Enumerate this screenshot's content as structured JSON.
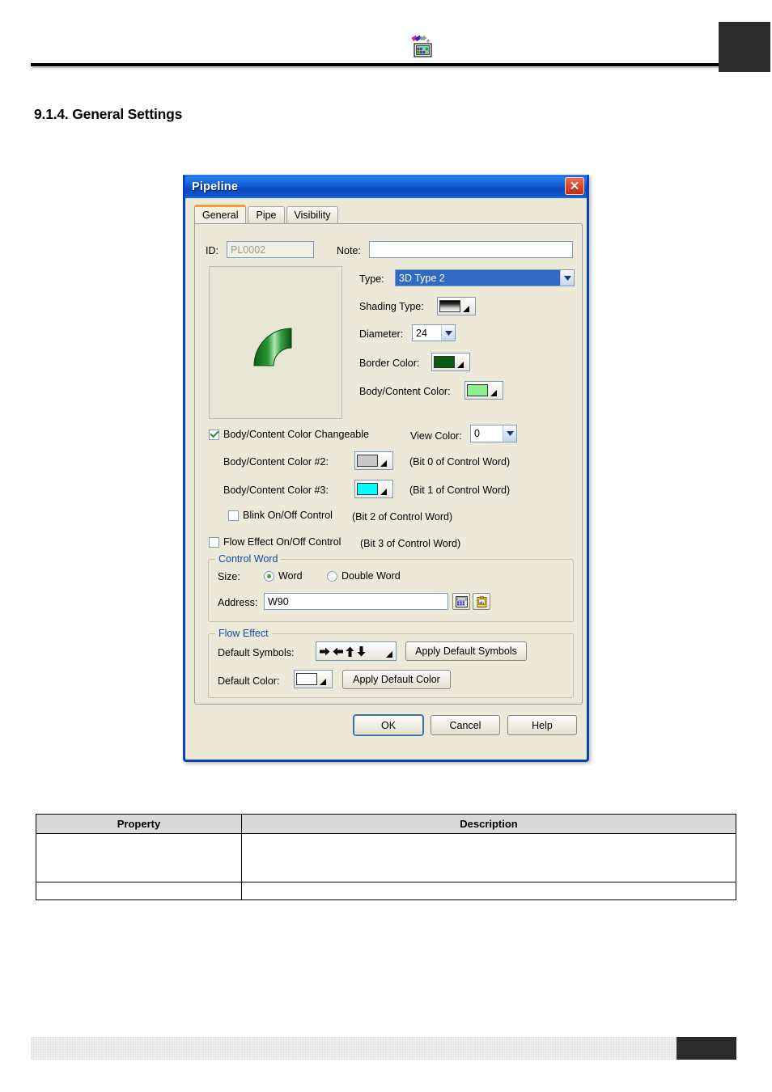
{
  "page": {
    "section_title": "9.1.4. General Settings",
    "header_icon": "palette-app-icon"
  },
  "dialog": {
    "title": "Pipeline",
    "close_label": "✕",
    "tabs": [
      {
        "label": "General",
        "active": true
      },
      {
        "label": "Pipe",
        "active": false
      },
      {
        "label": "Visibility",
        "active": false
      }
    ],
    "id_label": "ID:",
    "id_value": "PL0002",
    "note_label": "Note:",
    "note_value": "",
    "type_label": "Type:",
    "type_value": "3D Type 2",
    "shading_label": "Shading Type:",
    "shading_value": "black-to-white-gradient",
    "diameter_label": "Diameter:",
    "diameter_value": "24",
    "border_color_label": "Border Color:",
    "border_color_value": "#0a5a14",
    "body_color_label": "Body/Content Color:",
    "body_color_value": "#90ee90",
    "changeable_label": "Body/Content Color Changeable",
    "changeable_checked": true,
    "view_color_label": "View Color:",
    "view_color_value": "0",
    "color2_label": "Body/Content Color #2:",
    "color2_value": "#c8c8c8",
    "color2_hint": "(Bit 0 of Control Word)",
    "color3_label": "Body/Content Color #3:",
    "color3_value": "#00ffff",
    "color3_hint": "(Bit 1 of Control Word)",
    "blink_label": "Blink On/Off Control",
    "blink_checked": false,
    "blink_hint": "(Bit 2 of Control Word)",
    "flow_ctrl_label": "Flow Effect On/Off Control",
    "flow_ctrl_checked": false,
    "flow_ctrl_hint": "(Bit 3 of Control Word)",
    "control_word": {
      "group_title": "Control Word",
      "size_label": "Size:",
      "size_word": "Word",
      "size_dword": "Double Word",
      "size_selected": "Word",
      "address_label": "Address:",
      "address_value": "W90",
      "keypad_icon": "keypad-icon",
      "tag_icon": "tag-clipboard-icon"
    },
    "flow_effect": {
      "group_title": "Flow Effect",
      "default_symbols_label": "Default Symbols:",
      "default_symbols_value": "➜ ➜ ➜ ➜",
      "apply_symbols_label": "Apply Default Symbols",
      "default_color_label": "Default Color:",
      "default_color_value": "#ffffff",
      "apply_color_label": "Apply Default Color"
    },
    "buttons": {
      "ok": "OK",
      "cancel": "Cancel",
      "help": "Help"
    }
  },
  "property_table": {
    "headers": [
      "Property",
      "Description"
    ],
    "rows": [
      {
        "property": "",
        "description": ""
      },
      {
        "property": "",
        "description": ""
      }
    ]
  }
}
